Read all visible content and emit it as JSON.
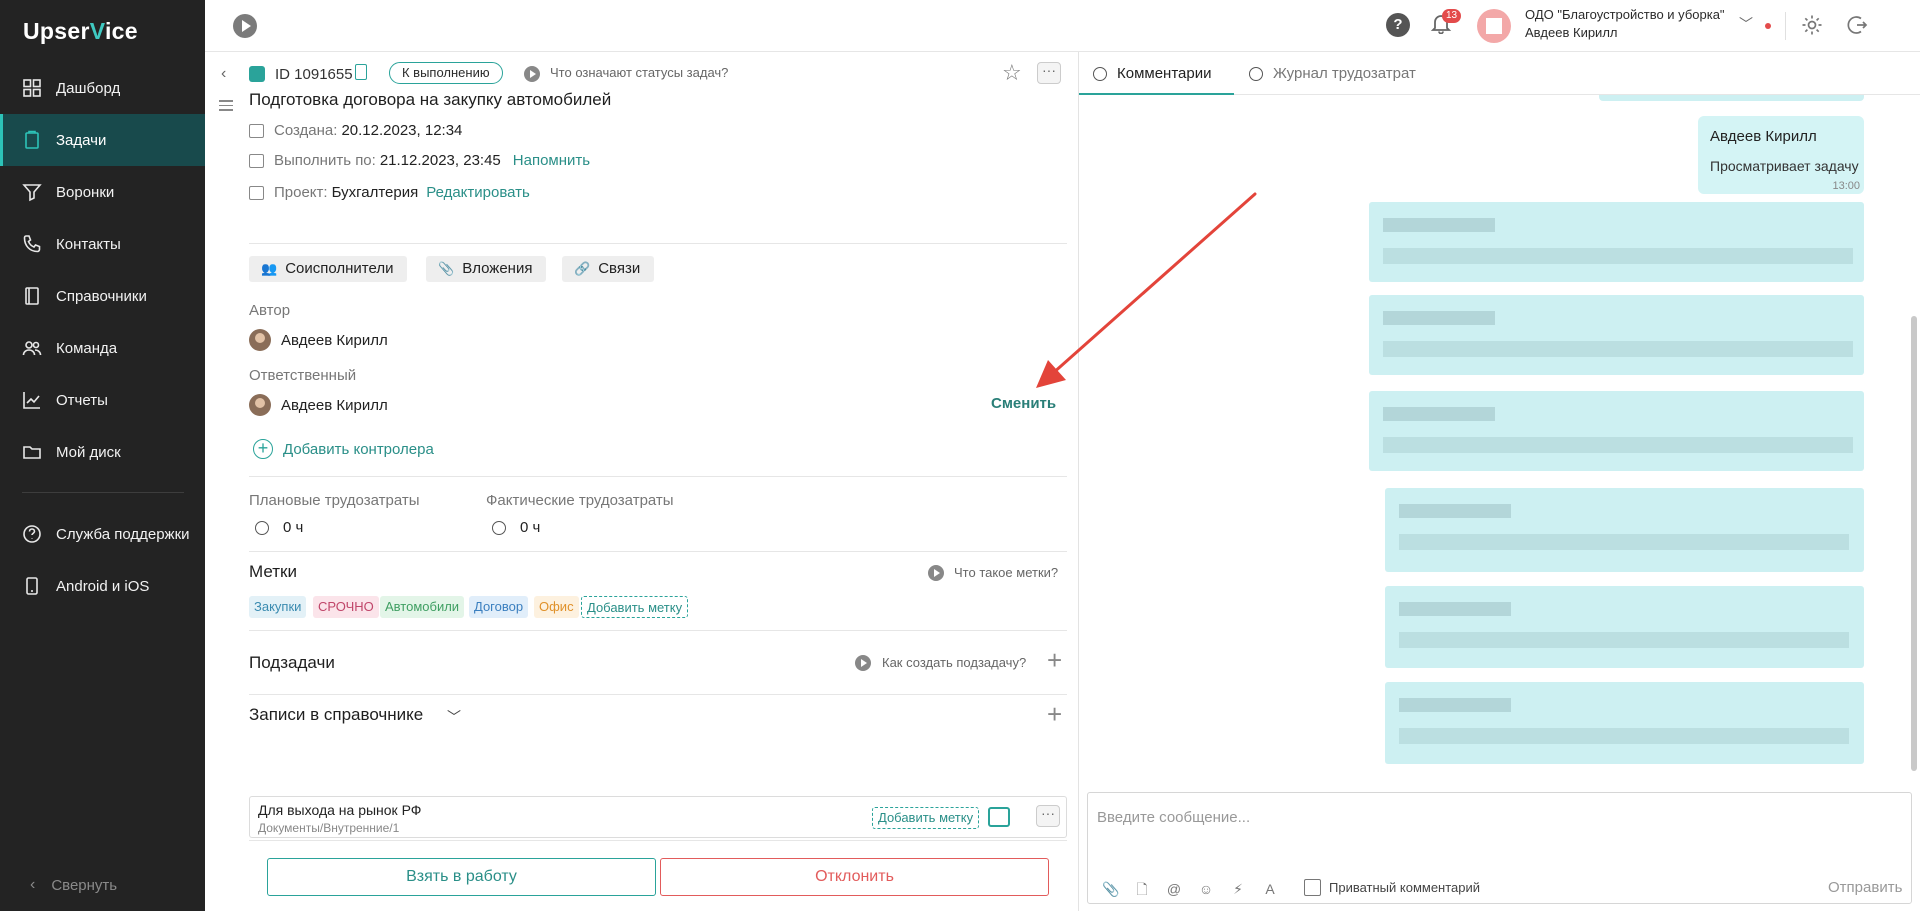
{
  "sidebar": {
    "logo_prefix": "Upser",
    "logo_v": "V",
    "logo_suffix": "ice",
    "items": [
      {
        "label": "Дашборд",
        "icon": "dashboard-icon"
      },
      {
        "label": "Задачи",
        "icon": "tasks-icon",
        "active": true
      },
      {
        "label": "Воронки",
        "icon": "funnel-icon"
      },
      {
        "label": "Контакты",
        "icon": "phone-icon"
      },
      {
        "label": "Справочники",
        "icon": "book-icon"
      },
      {
        "label": "Команда",
        "icon": "team-icon"
      },
      {
        "label": "Отчеты",
        "icon": "chart-icon"
      },
      {
        "label": "Мой диск",
        "icon": "folder-icon"
      }
    ],
    "support_label": "Служба поддержки",
    "mobile_label": "Android и iOS",
    "collapse_label": "Свернуть"
  },
  "topbar": {
    "help": "?",
    "notifications_count": "13",
    "org_name": "ОДО \"Благоустройство и уборка\"",
    "user_name": "Авдеев Кирилл"
  },
  "task": {
    "id": "ID 1091655",
    "status": "К выполнению",
    "status_help": "Что означают статусы задач?",
    "title": "Подготовка договора на закупку автомобилей",
    "created_label": "Создана:",
    "created_value": "20.12.2023, 12:34",
    "due_label": "Выполнить по:",
    "due_value": "21.12.2023, 23:45",
    "remind_link": "Напомнить",
    "project_label": "Проект:",
    "project_value": "Бухгалтерия",
    "edit_link": "Редактировать",
    "coexecutors": "Соисполнители",
    "attachments": "Вложения",
    "links": "Связи",
    "author_label": "Автор",
    "author_name": "Авдеев Кирилл",
    "responsible_label": "Ответственный",
    "responsible_name": "Авдеев Кирилл",
    "change_link": "Сменить",
    "add_controller": "Добавить контролера",
    "planned_label": "Плановые трудозатраты",
    "planned_value": "0 ч",
    "actual_label": "Фактические трудозатраты",
    "actual_value": "0 ч",
    "tags_title": "Метки",
    "tags_help": "Что такое метки?",
    "tags": [
      {
        "label": "Закупки",
        "bg": "#e3f1f7",
        "color": "#3a8bb0"
      },
      {
        "label": "СРОЧНО",
        "bg": "#fbe4ea",
        "color": "#c0466a"
      },
      {
        "label": "Автомобили",
        "bg": "#e3f5e8",
        "color": "#3f9f62"
      },
      {
        "label": "Договор",
        "bg": "#e1eefa",
        "color": "#3b7fbf"
      },
      {
        "label": "Офис",
        "bg": "#fdf1df",
        "color": "#e0912a"
      }
    ],
    "add_tag": "Добавить метку",
    "subtasks_title": "Подзадачи",
    "subtasks_help": "Как создать подзадачу?",
    "records_title": "Записи в справочнике",
    "record_title": "Для выхода на рынок РФ",
    "record_path": "Документы/Внутренние/1",
    "record_add_tag": "Добавить метку",
    "take_button": "Взять в работу",
    "reject_button": "Отклонить"
  },
  "comments": {
    "tab_comments": "Комментарии",
    "tab_journal": "Журнал трудозатрат",
    "message_author": "Авдеев Кирилл",
    "message_text": "Просматривает задачу",
    "message_time": "13:00",
    "placeholder": "Введите сообщение...",
    "private_label": "Приватный комментарий",
    "send_label": "Отправить"
  },
  "colors": {
    "accent": "#2aa39a",
    "sidebar_bg": "#232323",
    "danger": "#e25b5b",
    "arrow": "#e3443a"
  }
}
